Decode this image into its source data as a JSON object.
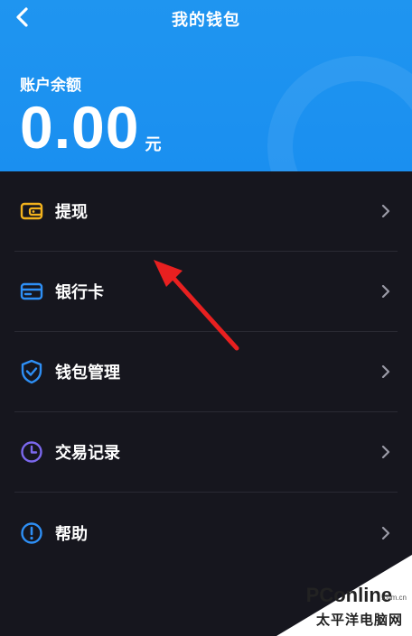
{
  "header": {
    "title": "我的钱包",
    "back_icon": "chevron-left-icon",
    "background_color": "#1a8ff0"
  },
  "balance": {
    "label": "账户余额",
    "amount": "0.00",
    "unit": "元"
  },
  "menu": {
    "items": [
      {
        "label": "提现",
        "icon": "wallet-icon",
        "icon_color": "#f2b21d"
      },
      {
        "label": "银行卡",
        "icon": "card-icon",
        "icon_color": "#2e8ff5"
      },
      {
        "label": "钱包管理",
        "icon": "shield-check-icon",
        "icon_color": "#2e8ff5"
      },
      {
        "label": "交易记录",
        "icon": "clock-icon",
        "icon_color": "#7b68ee"
      },
      {
        "label": "帮助",
        "icon": "info-icon",
        "icon_color": "#2e8ff5"
      }
    ]
  },
  "annotation": {
    "arrow_color": "#e82020"
  },
  "watermark": {
    "brand": "PConline",
    "domain": ".com.cn",
    "sub": "太平洋电脑网"
  }
}
